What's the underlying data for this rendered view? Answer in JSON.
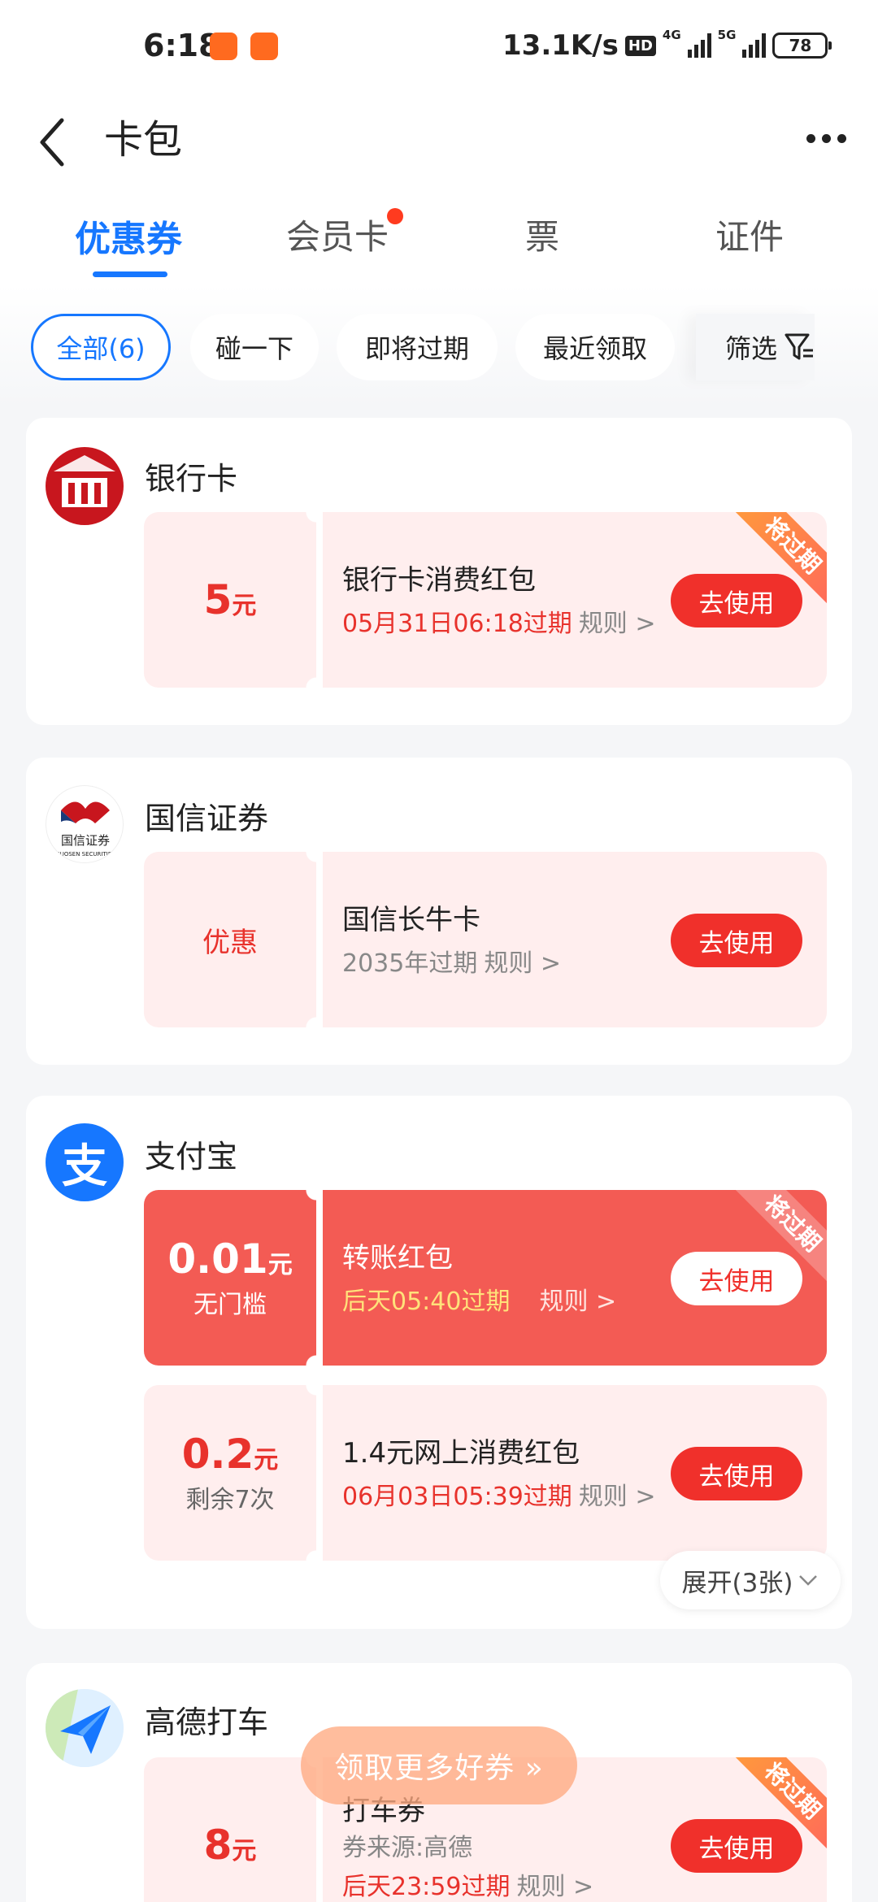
{
  "status_bar": {
    "time": "6:18",
    "network_speed": "13.1K/s",
    "hd_label": "HD",
    "net1": "4G",
    "net2": "5G",
    "battery": "78"
  },
  "header": {
    "title": "卡包"
  },
  "tabs": [
    {
      "label": "优惠券"
    },
    {
      "label": "会员卡"
    },
    {
      "label": "票"
    },
    {
      "label": "证件"
    }
  ],
  "filters": {
    "chips": [
      {
        "label": "全部(6)"
      },
      {
        "label": "碰一下"
      },
      {
        "label": "即将过期"
      },
      {
        "label": "最近领取"
      }
    ],
    "filter_label": "筛选"
  },
  "sections": [
    {
      "merchant": "银行卡",
      "coupons": [
        {
          "amount": "5",
          "unit": "元",
          "name": "银行卡消费红包",
          "expire": "05月31日06:18过期",
          "rule": "规则 >",
          "button": "去使用",
          "ribbon": "将过期"
        }
      ]
    },
    {
      "merchant": "国信证券",
      "logo_text": "国信证券",
      "logo_sub": "GUOSEN SECURITIES",
      "coupons": [
        {
          "amount": "优惠",
          "name": "国信长牛卡",
          "expire": "2035年过期",
          "rule": "规则 >",
          "button": "去使用"
        }
      ]
    },
    {
      "merchant": "支付宝",
      "logo_glyph": "支",
      "coupons": [
        {
          "amount": "0.01",
          "unit": "元",
          "sub": "无门槛",
          "name": "转账红包",
          "expire": "后天05:40过期",
          "rule": "规则 >",
          "button": "去使用",
          "ribbon": "将过期"
        },
        {
          "amount": "0.2",
          "unit": "元",
          "sub": "剩余7次",
          "name": "1.4元网上消费红包",
          "expire": "06月03日05:39过期",
          "rule": "规则 >",
          "button": "去使用"
        }
      ],
      "expand": "展开(3张)"
    },
    {
      "merchant": "高德打车",
      "coupons": [
        {
          "amount": "8",
          "unit": "元",
          "name": "打车券",
          "source": "券来源:高德",
          "expire": "后天23:59过期",
          "rule": "规则 >",
          "button": "去使用",
          "ribbon": "将过期"
        }
      ]
    }
  ],
  "floating_button": "领取更多好券 »",
  "colors": {
    "accent": "#1677ff",
    "red": "#f0302b",
    "coupon_bg": "#ffeeee"
  }
}
